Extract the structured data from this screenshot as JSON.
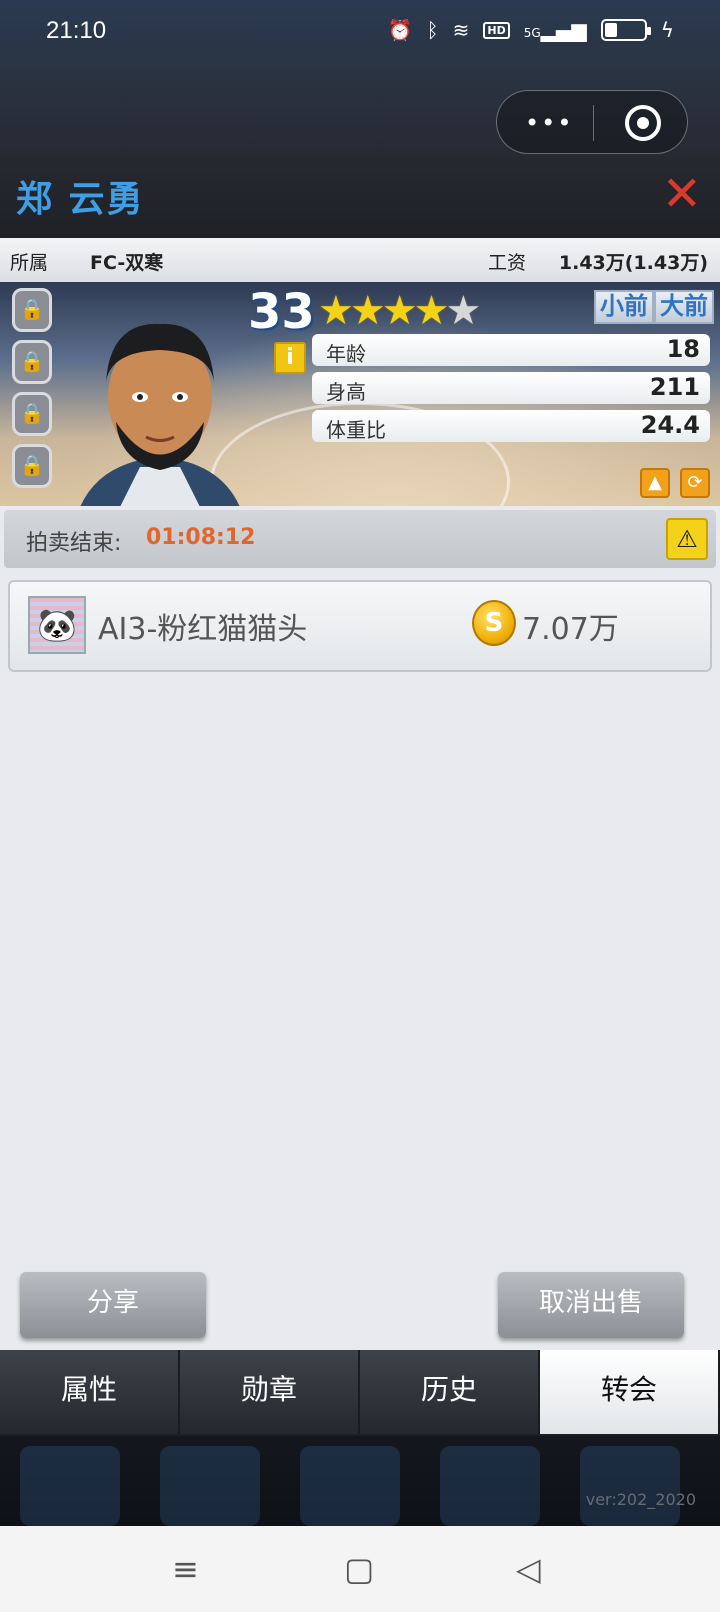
{
  "status_bar": {
    "time": "21:10",
    "icons": [
      "alarm-icon",
      "bluetooth-icon",
      "wifi-icon",
      "hd-icon",
      "5g-signal-icon",
      "battery-icon",
      "charging-icon"
    ],
    "hd": "HD",
    "network": "5G"
  },
  "capsule": {
    "more": "•••",
    "close": "target-icon"
  },
  "header": {
    "player_name": "郑 云勇",
    "close": "✕"
  },
  "info_row": {
    "club_label": "所属",
    "club_value": "FC-双寒",
    "salary_label": "工资",
    "salary_value": "1.43万(1.43万)"
  },
  "player": {
    "rating": "33",
    "stars": 3.5,
    "stars_total": 5,
    "positions": [
      "小前",
      "大前"
    ],
    "info": "i",
    "stats": [
      {
        "label": "年龄",
        "value": "18"
      },
      {
        "label": "身高",
        "value": "211"
      },
      {
        "label": "体重比",
        "value": "24.4"
      }
    ]
  },
  "auction": {
    "label": "拍卖结束:",
    "time_left": "01:08:12"
  },
  "bid": {
    "team": "AI3-粉红猫猫头",
    "coin": "S",
    "price": "7.07万"
  },
  "actions": {
    "share": "分享",
    "cancel_sale": "取消出售"
  },
  "tabs": [
    {
      "label": "属性",
      "active": false
    },
    {
      "label": "勋章",
      "active": false
    },
    {
      "label": "历史",
      "active": false
    },
    {
      "label": "转会",
      "active": true
    }
  ],
  "version": "ver:202_2020",
  "colors": {
    "accent": "#3e9ee6",
    "countdown": "#e0672b",
    "close": "#d83a2e"
  }
}
